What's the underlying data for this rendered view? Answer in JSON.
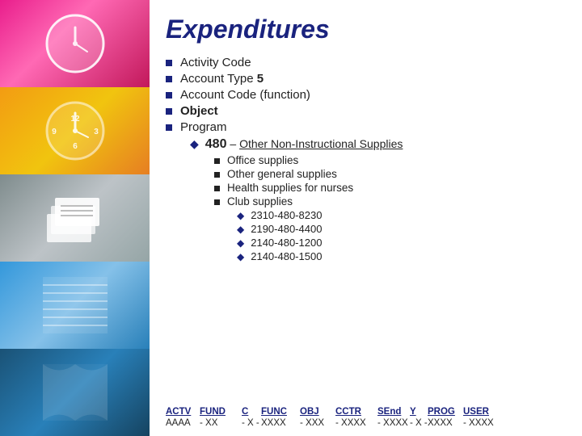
{
  "title": "Expenditures",
  "sidebar": {
    "images": [
      {
        "name": "clock-pink",
        "class": "img-clock-pink"
      },
      {
        "name": "clock-yellow",
        "class": "img-clock-yellow"
      },
      {
        "name": "papers",
        "class": "img-papers"
      },
      {
        "name": "fabric",
        "class": "img-fabric"
      },
      {
        "name": "blue-fabric",
        "class": "img-blue-fabric"
      }
    ]
  },
  "top_list": [
    {
      "text": "Activity Code",
      "bold": false
    },
    {
      "text": "Account Type ",
      "bold": false,
      "bold_part": "5"
    },
    {
      "text": "Account Code (function)",
      "bold": false
    },
    {
      "text": "Object",
      "bold": true
    },
    {
      "text": "Program",
      "bold": false
    }
  ],
  "program_sub": {
    "code": "480",
    "dash": " – ",
    "label": "Other Non-Instructional Supplies"
  },
  "sub_items": [
    "Office supplies",
    "Other general supplies",
    "Health supplies for nurses",
    "Club supplies"
  ],
  "code_items": [
    "2310-480-8230",
    "2190-480-4400",
    "2140-480-1200",
    "2140-480-1500"
  ],
  "bottom": {
    "headers": [
      "ACTV",
      "FUND",
      "C",
      "FUNC",
      "OBJ",
      "CCTR",
      "SEnd",
      "Y",
      "PROG",
      "USER"
    ],
    "data": [
      "AAAA",
      "-  XX",
      "-  X  -",
      "XXXX",
      "-  XXX",
      "-  XXXX",
      "-  XXXX",
      "-  X  -",
      "XXXX",
      "-  XXXX"
    ]
  }
}
